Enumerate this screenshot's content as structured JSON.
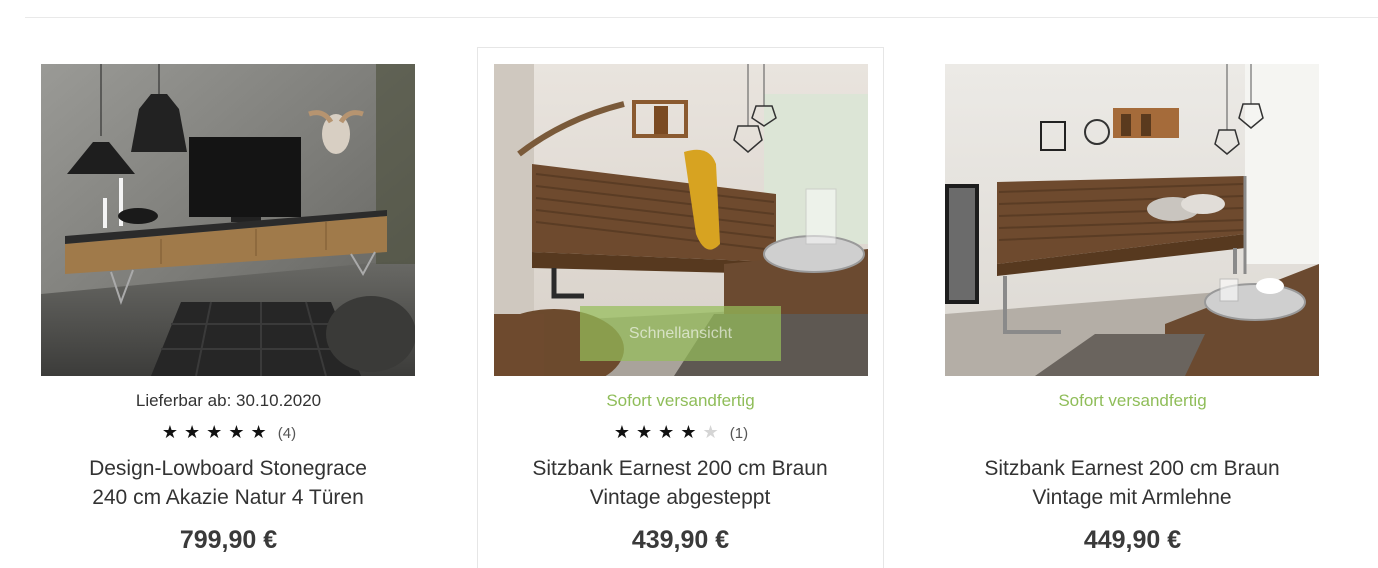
{
  "products": [
    {
      "delivery": "Lieferbar ab: 30.10.2020",
      "delivery_color": "#333333",
      "rating": 5,
      "rating_max": 5,
      "review_count": "(4)",
      "title_line1": "Design-Lowboard Stonegrace",
      "title_line2": "240 cm Akazie Natur 4 Türen",
      "price": "799,90 €"
    },
    {
      "delivery": "Sofort versandfertig",
      "delivery_color": "#8fbd59",
      "rating": 4,
      "rating_max": 5,
      "review_count": "(1)",
      "title_line1": "Sitzbank Earnest 200 cm Braun",
      "title_line2": "Vintage abgesteppt",
      "price": "439,90 €",
      "quickview_label": "Schnellansicht"
    },
    {
      "delivery": "Sofort versandfertig",
      "delivery_color": "#8fbd59",
      "title_line1": "Sitzbank Earnest 200 cm Braun",
      "title_line2": "Vintage mit Armlehne",
      "price": "449,90 €"
    }
  ]
}
